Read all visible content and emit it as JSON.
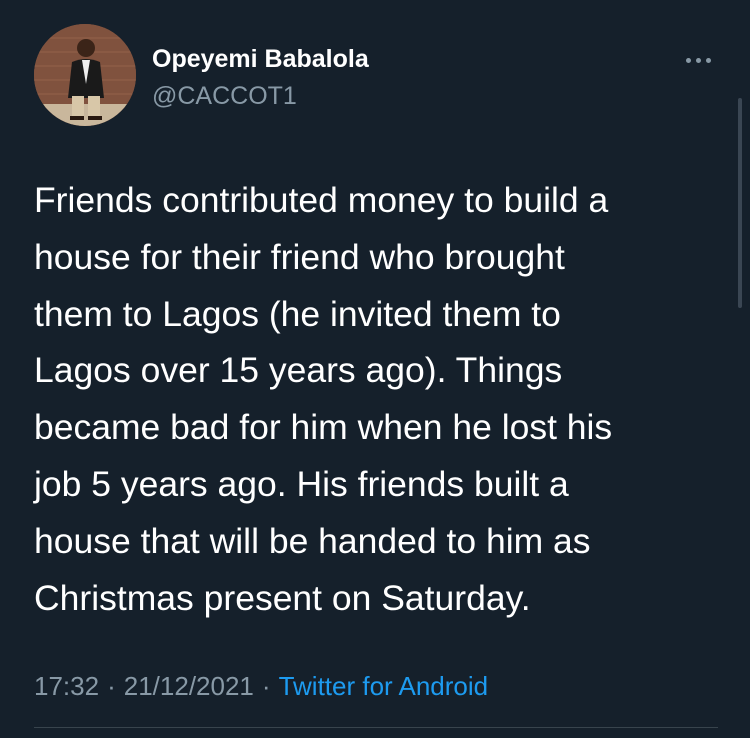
{
  "tweet": {
    "display_name": "Opeyemi Babalola",
    "handle": "@CACCOT1",
    "more_icon": "more-horizontal-icon",
    "text": "Friends contributed money to build a\nhouse for their friend who brought\nthem to Lagos (he invited them to\nLagos over 15 years ago). Things\nbecame bad for him when he lost his\njob 5 years ago. His friends built a\nhouse that will be handed to him as\nChristmas present on Saturday.",
    "time": "17:32",
    "separator": "·",
    "date": "21/12/2021",
    "source": "Twitter for Android"
  },
  "colors": {
    "background": "#15202b",
    "primary_text": "#ffffff",
    "secondary_text": "#8899a6",
    "link": "#1d9bf0",
    "divider": "#38444d"
  }
}
